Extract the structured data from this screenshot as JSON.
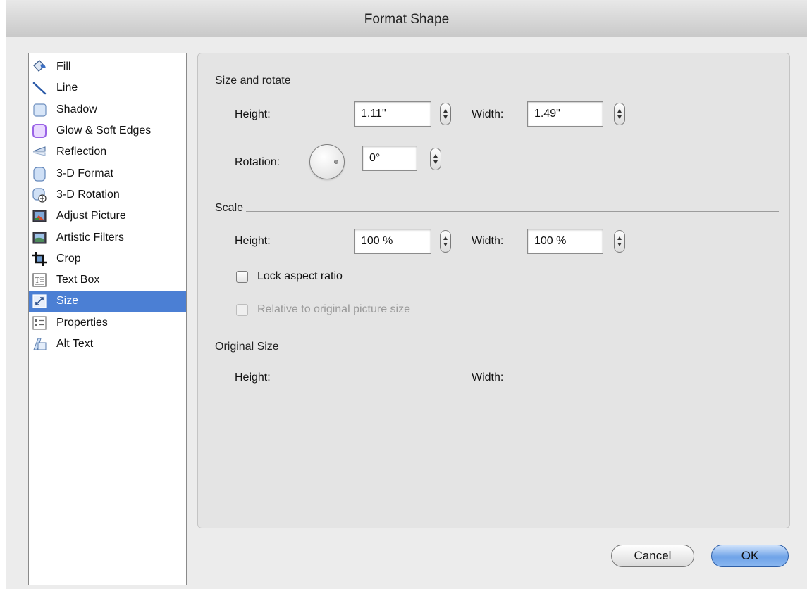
{
  "window": {
    "title": "Format Shape"
  },
  "categories": [
    {
      "label": "Fill",
      "icon": "paint-bucket-icon"
    },
    {
      "label": "Line",
      "icon": "line-icon"
    },
    {
      "label": "Shadow",
      "icon": "shadow-icon"
    },
    {
      "label": "Glow & Soft Edges",
      "icon": "glow-icon"
    },
    {
      "label": "Reflection",
      "icon": "reflection-icon"
    },
    {
      "label": "3-D Format",
      "icon": "3d-format-icon"
    },
    {
      "label": "3-D Rotation",
      "icon": "3d-rotation-icon"
    },
    {
      "label": "Adjust Picture",
      "icon": "adjust-picture-icon"
    },
    {
      "label": "Artistic Filters",
      "icon": "artistic-filters-icon"
    },
    {
      "label": "Crop",
      "icon": "crop-icon"
    },
    {
      "label": "Text Box",
      "icon": "text-box-icon"
    },
    {
      "label": "Size",
      "icon": "size-icon",
      "selected": true
    },
    {
      "label": "Properties",
      "icon": "properties-icon"
    },
    {
      "label": "Alt Text",
      "icon": "alt-text-icon"
    }
  ],
  "size_rotate": {
    "title": "Size and rotate",
    "height_label": "Height:",
    "height_value": "1.11\"",
    "width_label": "Width:",
    "width_value": "1.49\"",
    "rotation_label": "Rotation:",
    "rotation_value": "0°"
  },
  "scale": {
    "title": "Scale",
    "height_label": "Height:",
    "height_value": "100 %",
    "width_label": "Width:",
    "width_value": "100 %",
    "lock_label": "Lock aspect ratio",
    "lock_checked": false,
    "relative_label": "Relative to original picture size",
    "relative_checked": false,
    "relative_enabled": false
  },
  "original_size": {
    "title": "Original Size",
    "height_label": "Height:",
    "width_label": "Width:"
  },
  "buttons": {
    "cancel": "Cancel",
    "ok": "OK"
  },
  "colors": {
    "selection": "#4b7fd4",
    "default_button": "#6fa3e8"
  }
}
